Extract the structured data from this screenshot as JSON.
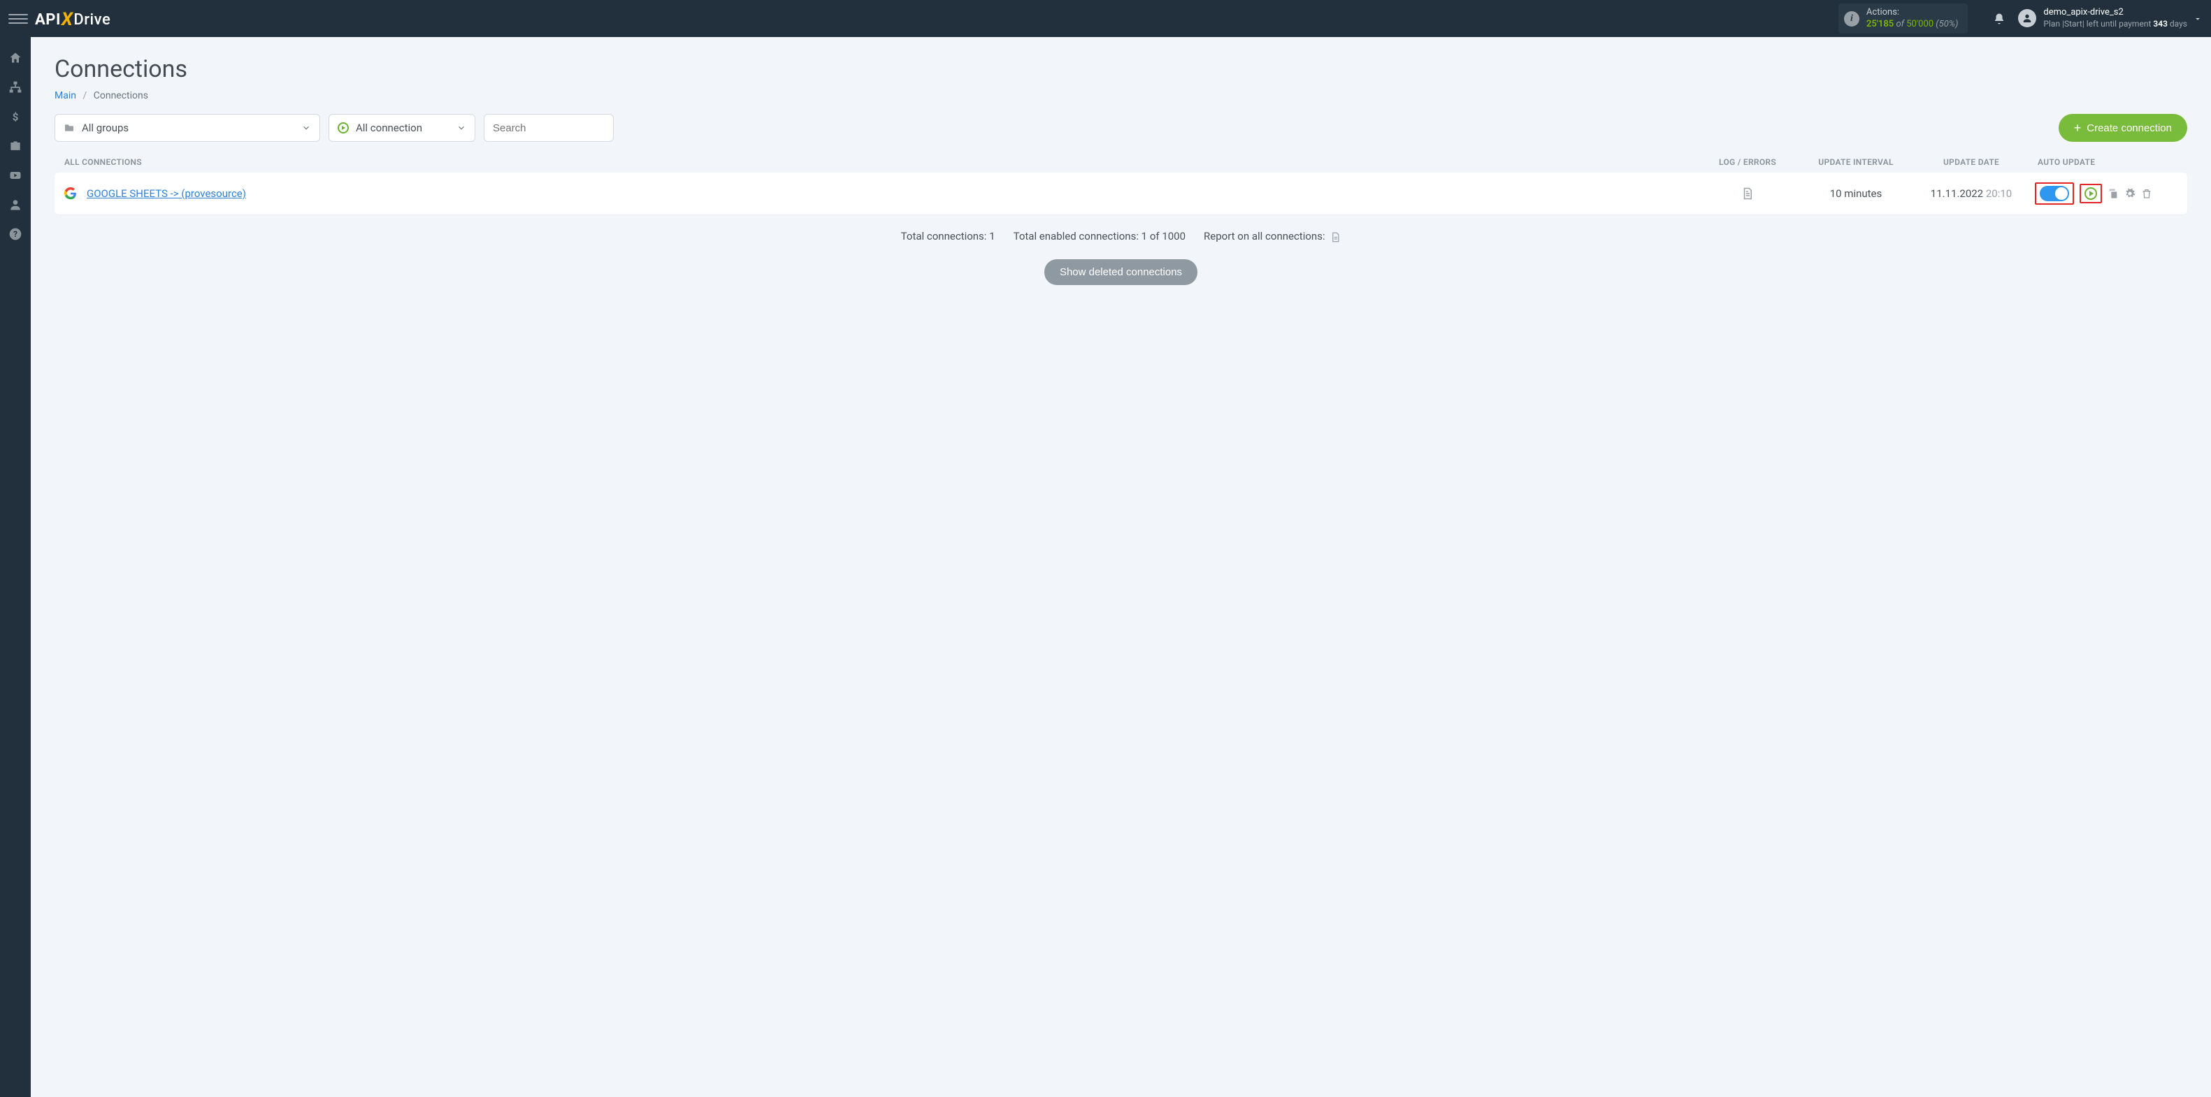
{
  "header": {
    "logo_a": "API",
    "logo_b": "Drive",
    "actions_label": "Actions:",
    "actions_used": "25'185",
    "actions_of": "of",
    "actions_total": "50'000",
    "actions_pct": "(50%)",
    "username": "demo_apix-drive_s2",
    "plan_prefix": "Plan |Start| left until payment ",
    "plan_days": "343",
    "plan_suffix": " days"
  },
  "page": {
    "title": "Connections",
    "breadcrumb_main": "Main",
    "breadcrumb_current": "Connections"
  },
  "filters": {
    "groups_label": "All groups",
    "conn_label": "All connection",
    "search_placeholder": "Search",
    "create_label": "Create connection"
  },
  "table": {
    "head_name": "ALL CONNECTIONS",
    "head_log": "LOG / ERRORS",
    "head_interval": "UPDATE INTERVAL",
    "head_date": "UPDATE DATE",
    "head_auto": "AUTO UPDATE",
    "row": {
      "name": "GOOGLE SHEETS -> (provesource)",
      "interval": "10 minutes",
      "date": "11.11.2022",
      "time": "20:10"
    }
  },
  "summary": {
    "total": "Total connections: 1",
    "enabled": "Total enabled connections: 1 of 1000",
    "report": "Report on all connections:"
  },
  "buttons": {
    "show_deleted": "Show deleted connections"
  }
}
